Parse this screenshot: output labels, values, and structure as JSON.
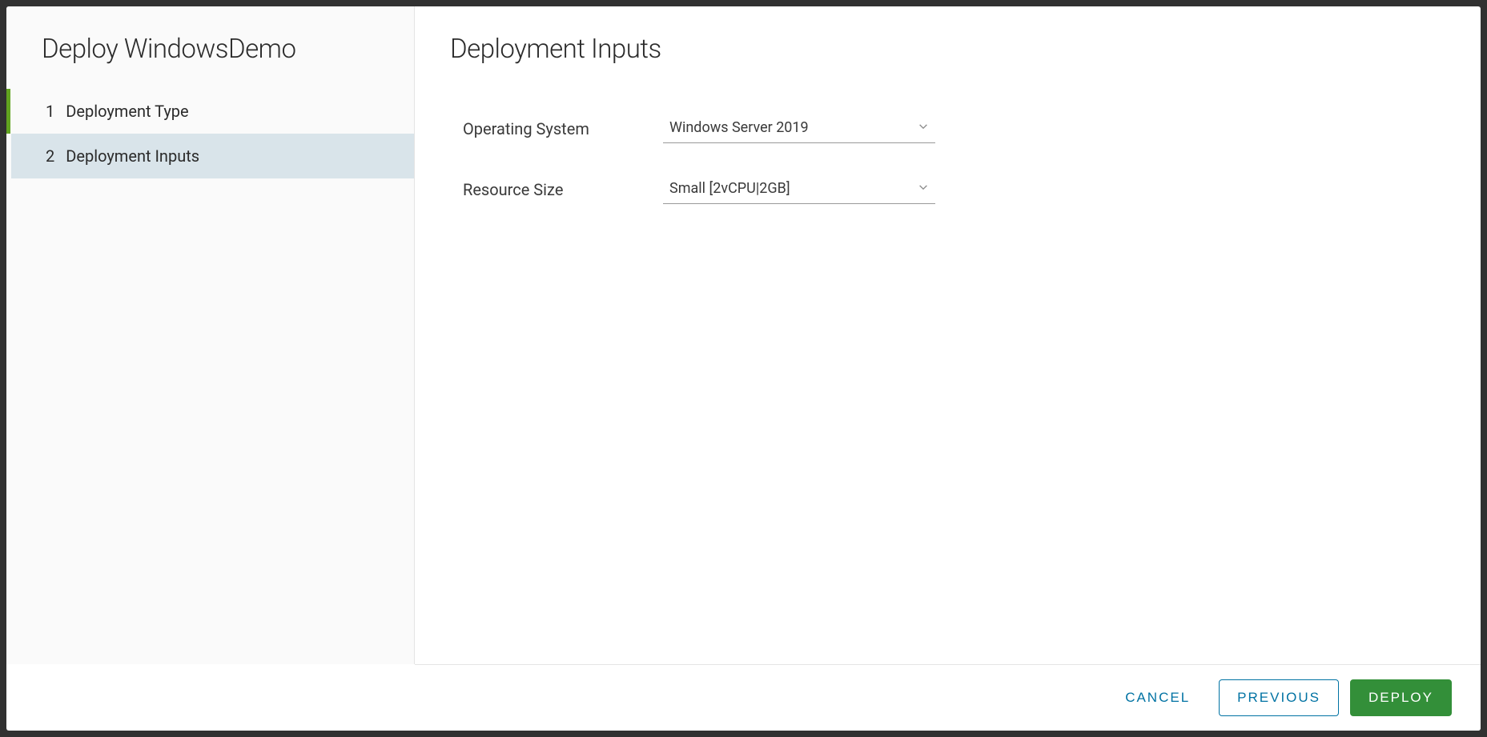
{
  "sidebar": {
    "title": "Deploy WindowsDemo",
    "steps": [
      {
        "num": "1",
        "label": "Deployment Type"
      },
      {
        "num": "2",
        "label": "Deployment Inputs"
      }
    ]
  },
  "content": {
    "title": "Deployment Inputs",
    "fields": {
      "os": {
        "label": "Operating System",
        "value": "Windows Server 2019"
      },
      "size": {
        "label": "Resource Size",
        "value": "Small [2vCPU|2GB]"
      }
    }
  },
  "footer": {
    "cancel": "CANCEL",
    "previous": "PREVIOUS",
    "deploy": "DEPLOY"
  }
}
